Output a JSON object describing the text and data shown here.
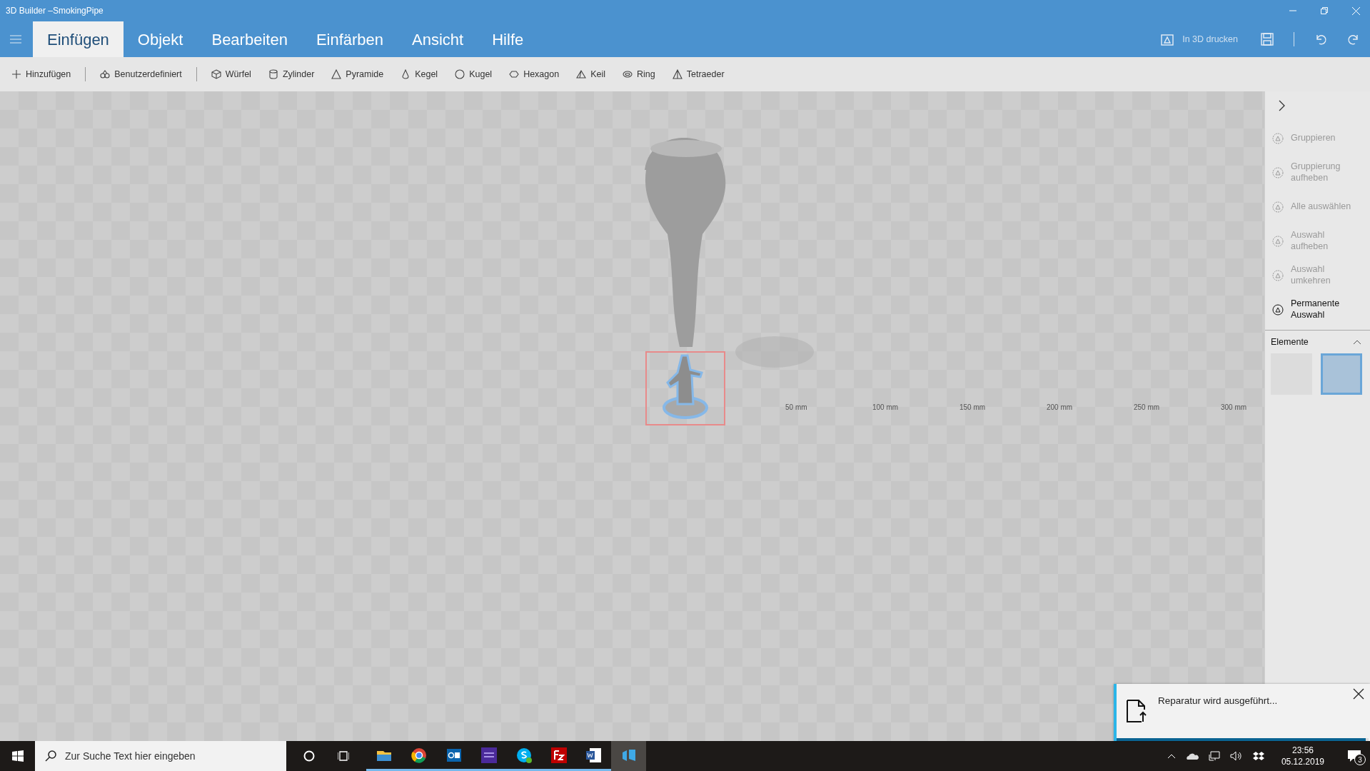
{
  "window": {
    "title": "3D Builder –SmokingPipe"
  },
  "ribbon": {
    "tabs": [
      {
        "label": "Einfügen",
        "selected": true
      },
      {
        "label": "Objekt",
        "selected": false
      },
      {
        "label": "Bearbeiten",
        "selected": false
      },
      {
        "label": "Einfärben",
        "selected": false
      },
      {
        "label": "Ansicht",
        "selected": false
      },
      {
        "label": "Hilfe",
        "selected": false
      }
    ],
    "print_label": "In 3D drucken"
  },
  "toolbar": {
    "items": [
      {
        "label": "Hinzufügen"
      },
      {
        "label": "Benutzerdefiniert"
      },
      {
        "label": "Würfel"
      },
      {
        "label": "Zylinder"
      },
      {
        "label": "Pyramide"
      },
      {
        "label": "Kegel"
      },
      {
        "label": "Kugel"
      },
      {
        "label": "Hexagon"
      },
      {
        "label": "Keil"
      },
      {
        "label": "Ring"
      },
      {
        "label": "Tetraeder"
      }
    ]
  },
  "panel": {
    "actions": [
      {
        "label": "Gruppieren",
        "disabled": true
      },
      {
        "label": "Gruppierung aufheben",
        "disabled": true
      },
      {
        "label": "Alle auswählen",
        "disabled": true
      },
      {
        "label": "Auswahl aufheben",
        "disabled": true
      },
      {
        "label": "Auswahl umkehren",
        "disabled": true
      },
      {
        "label": "Permanente Auswahl",
        "disabled": false
      }
    ],
    "section": {
      "title": "Elemente",
      "expanded": true
    },
    "thumbnails": [
      {
        "selected": false
      },
      {
        "selected": true
      }
    ]
  },
  "viewport": {
    "ruler_labels": [
      "50 mm",
      "100 mm",
      "150 mm",
      "200 mm",
      "250 mm",
      "300 mm"
    ]
  },
  "notification": {
    "message": "Reparatur wird ausgeführt...",
    "level": 0.99
  },
  "taskbar": {
    "search": {
      "placeholder": "Zur Suche Text hier eingeben"
    },
    "apps": [
      {
        "running": true,
        "selected": false
      },
      {
        "running": true,
        "selected": false
      },
      {
        "running": true,
        "selected": false
      },
      {
        "running": true,
        "selected": false
      },
      {
        "running": true,
        "selected": false
      },
      {
        "running": true,
        "selected": false
      },
      {
        "running": true,
        "selected": false
      },
      {
        "running": false,
        "selected": true
      }
    ],
    "time": "23:56",
    "date": "05.12.2019",
    "notification_count": "3"
  }
}
